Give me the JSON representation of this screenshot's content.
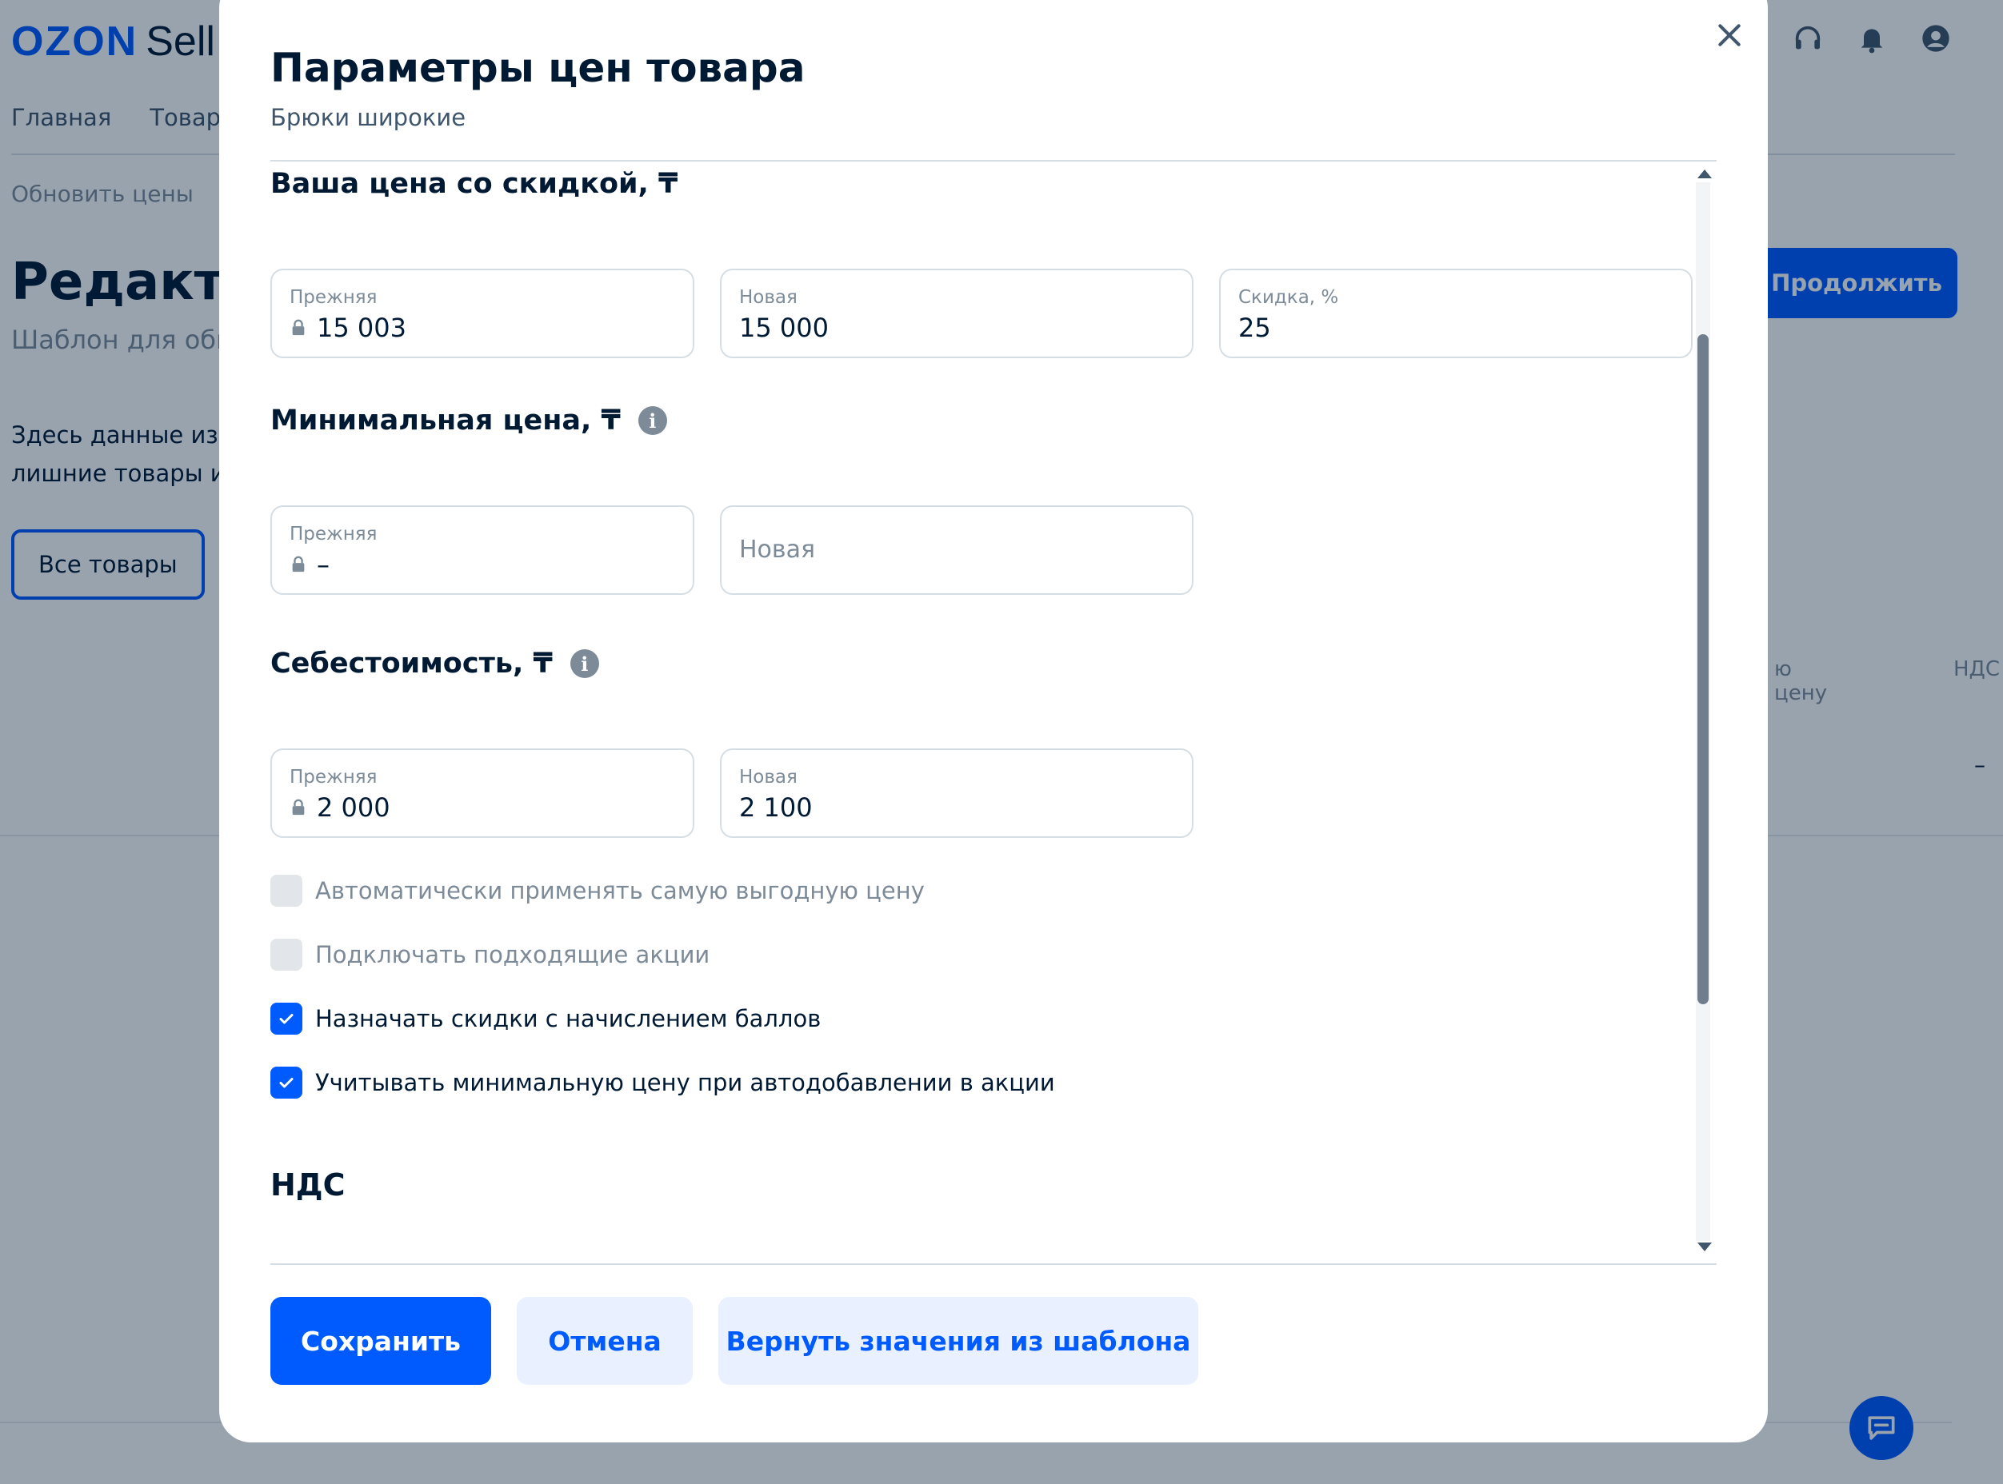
{
  "app": {
    "logo_brand": "OZON",
    "logo_suffix": "Sell"
  },
  "nav": {
    "items": [
      {
        "label": "Главная"
      },
      {
        "label": "Товары"
      }
    ]
  },
  "breadcrumb": "Обновить цены",
  "page": {
    "title": "Редакти",
    "subtitle": "Шаблон для обн",
    "description_line1": "Здесь данные из в",
    "description_line2": "лишние товары и",
    "all_goods_button": "Все товары",
    "continue_button": "Продолжить"
  },
  "table": {
    "columns": [
      "ю цену",
      "НДС"
    ],
    "row_value": "–"
  },
  "modal": {
    "title": "Параметры цен товара",
    "subtitle": "Брюки широкие",
    "sections": {
      "discount_price": {
        "title": "Ваша цена со скидкой, ₸",
        "fields": [
          {
            "label": "Прежняя",
            "value": "15 003",
            "locked": true
          },
          {
            "label": "Новая",
            "value": "15 000"
          },
          {
            "label": "Скидка, %",
            "value": "25"
          }
        ]
      },
      "min_price": {
        "title": "Минимальная цена, ₸",
        "fields": [
          {
            "label": "Прежняя",
            "value": "–",
            "locked": true
          },
          {
            "placeholder": "Новая"
          }
        ]
      },
      "cost_price": {
        "title": "Себестоимость, ₸",
        "fields": [
          {
            "label": "Прежняя",
            "value": "2 000",
            "locked": true
          },
          {
            "label": "Новая",
            "value": "2 100"
          }
        ]
      },
      "nds": {
        "title": "НДС"
      }
    },
    "checkboxes": [
      {
        "label": "Автоматически применять самую выгодную цену",
        "checked": false,
        "disabled": true
      },
      {
        "label": "Подключать подходящие акции",
        "checked": false,
        "disabled": true
      },
      {
        "label": "Назначать скидки с начислением баллов",
        "checked": true
      },
      {
        "label": "Учитывать минимальную цену при автодобавлении в акции",
        "checked": true
      }
    ],
    "buttons": {
      "save": "Сохранить",
      "cancel": "Отмена",
      "reset": "Вернуть значения из шаблона"
    }
  },
  "colors": {
    "accent": "#005bff",
    "text_primary": "#001a34",
    "text_secondary": "#7d8b99",
    "secondary_button_bg": "#e9f0ff",
    "overlay": "rgba(0, 26, 52, 0.40)"
  }
}
